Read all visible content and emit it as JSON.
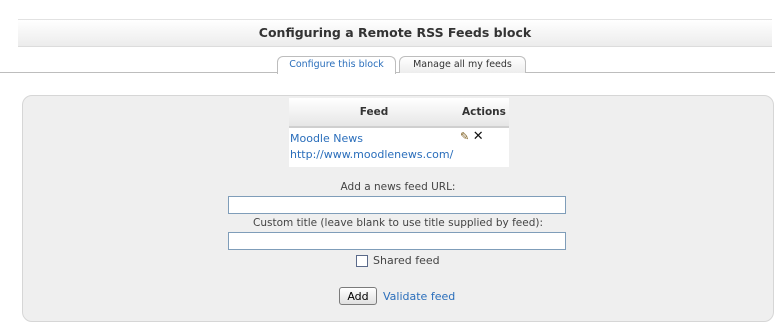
{
  "header": {
    "title": "Configuring a Remote RSS Feeds block"
  },
  "tabs": [
    {
      "label": "Configure this block",
      "active": true
    },
    {
      "label": "Manage all my feeds",
      "active": false
    }
  ],
  "feeds_table": {
    "headers": [
      "Feed",
      "Actions"
    ],
    "rows": [
      {
        "title": "Moodle News",
        "url": "http://www.moodlenews.com/",
        "actions": [
          "edit-icon",
          "delete-icon"
        ]
      }
    ]
  },
  "form": {
    "url_label": "Add a news feed URL:",
    "url_value": "",
    "title_label": "Custom title (leave blank to use title supplied by feed):",
    "title_value": "",
    "shared_label": "Shared feed",
    "shared_checked": false,
    "add_button": "Add",
    "validate_link": "Validate feed"
  },
  "colors": {
    "link": "#2a6ebb",
    "panel_bg": "#efefef"
  }
}
